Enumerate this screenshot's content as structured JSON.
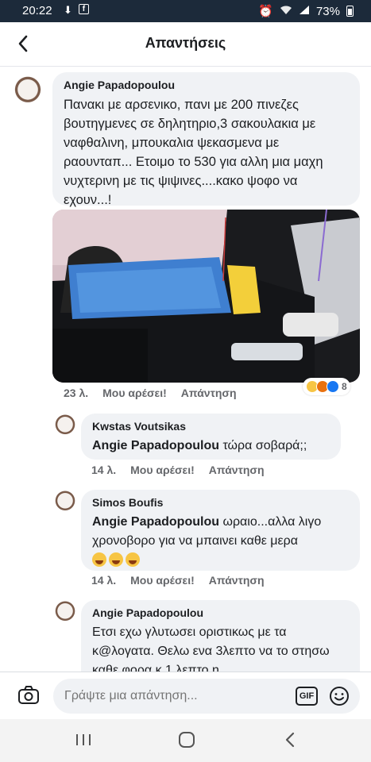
{
  "status_bar": {
    "time": "20:22",
    "battery": "73%"
  },
  "header": {
    "title": "Απαντήσεις"
  },
  "comments": [
    {
      "author": "Angie Papadopoulou",
      "text": "Πανακι με αρσενικο, πανι με 200 πινεζες βουτηγμενες σε δηλητηριο,3 σακουλακια με ναφθαλινη, μπουκαλια ψεκασμενα με ραουνταπ... Ετοιμο το 530 για αλλη μια μαχη νυχτερινη με τις ψιψινες....κακο ψοφο να εχουν...!",
      "time": "23 λ.",
      "like_label": "Μου αρέσει!",
      "reply_label": "Απάντηση",
      "reaction_count": "8"
    },
    {
      "author": "Kwstas Voutsikas",
      "mention": "Angie Papadopoulou",
      "text": "τώρα σοβαρά;;",
      "time": "14 λ.",
      "like_label": "Μου αρέσει!",
      "reply_label": "Απάντηση"
    },
    {
      "author": "Simos Boufis",
      "mention": "Angie Papadopoulou",
      "text": "ωραιο...αλλα λιγο χρονοβορο  για να μπαινει καθε μερα",
      "time": "14 λ.",
      "like_label": "Μου αρέσει!",
      "reply_label": "Απάντηση"
    },
    {
      "author": "Angie Papadopoulou",
      "text": "Ετσι εχω γλυτωσει οριστικως με τα κ@λογατα. Θελω ενα 3λεπτο να το στησω καθε φορα κ 1 λεπτο η"
    }
  ],
  "composer": {
    "placeholder": "Γράψτε μια απάντηση...",
    "gif_label": "GIF"
  },
  "icons": {
    "back": "back-arrow-icon",
    "camera": "camera-icon",
    "emoji": "emoji-icon",
    "nav_recent": "recent-apps-icon",
    "nav_home": "home-icon",
    "nav_back": "nav-back-icon"
  },
  "colors": {
    "status_bar": "#1c2a3a",
    "bubble": "#f0f2f5",
    "meta_text": "#65676b"
  }
}
